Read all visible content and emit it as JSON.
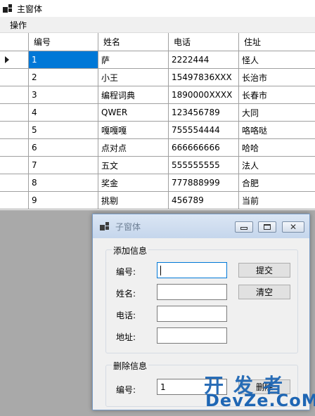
{
  "main_window": {
    "title": "主窗体",
    "menu": [
      "操作"
    ]
  },
  "grid": {
    "columns": [
      "编号",
      "姓名",
      "电话",
      "住址"
    ],
    "rows": [
      [
        "1",
        "萨",
        "2222444",
        "怪人"
      ],
      [
        "2",
        "小王",
        "15497836XXX",
        "长治市"
      ],
      [
        "3",
        "编程词典",
        "1890000XXXX",
        "长春市"
      ],
      [
        "4",
        "QWER",
        "123456789",
        "大同"
      ],
      [
        "5",
        "嘎嘎嘎",
        "755554444",
        "咯咯哒"
      ],
      [
        "6",
        "点对点",
        "666666666",
        "哈哈"
      ],
      [
        "7",
        "五文",
        "555555555",
        "法人"
      ],
      [
        "8",
        "奖金",
        "777888999",
        "合肥"
      ],
      [
        "9",
        "挑剔",
        "456789",
        "当前"
      ]
    ],
    "selected_row_index": 0
  },
  "child_window": {
    "title": "子窗体",
    "add_group": {
      "legend": "添加信息",
      "fields": [
        {
          "label": "编号:",
          "value": ""
        },
        {
          "label": "姓名:",
          "value": ""
        },
        {
          "label": "电话:",
          "value": ""
        },
        {
          "label": "地址:",
          "value": ""
        }
      ],
      "submit_label": "提交",
      "clear_label": "清空"
    },
    "delete_group": {
      "legend": "删除信息",
      "id_label": "编号:",
      "id_value": "1",
      "delete_label": "删除"
    }
  },
  "watermark": {
    "line1": "开发者",
    "line2": "DevZe.CoM"
  },
  "colors": {
    "selection": "#0078d7",
    "desktop": "#a9a9a9",
    "watermark": "#1e66b4"
  }
}
